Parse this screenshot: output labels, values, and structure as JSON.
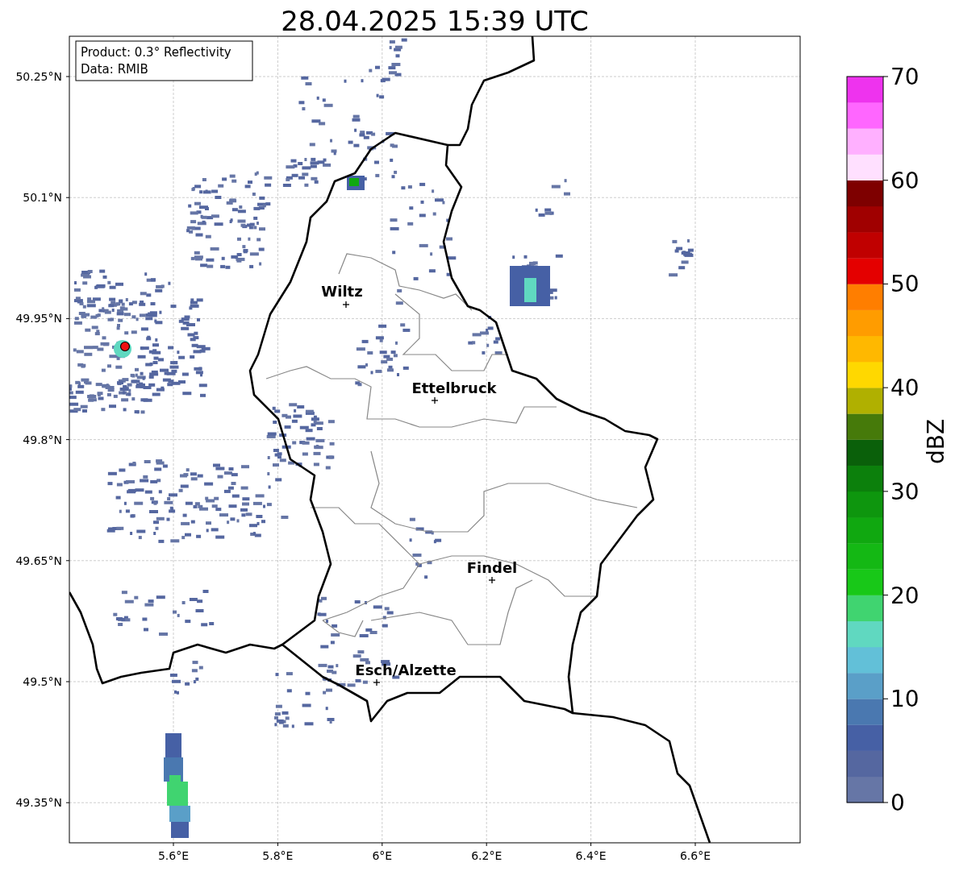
{
  "title": "28.04.2025 15:39 UTC",
  "info_box": [
    "Product: 0.3° Reflectivity",
    "Data: RMIB"
  ],
  "y_ticks": [
    "50.25°N",
    "50.1°N",
    "49.95°N",
    "49.8°N",
    "49.65°N",
    "49.5°N",
    "49.35°N"
  ],
  "x_ticks": [
    "5.6°E",
    "5.8°E",
    "6°E",
    "6.2°E",
    "6.4°E",
    "6.6°E"
  ],
  "cities": [
    {
      "name": "Wiltz"
    },
    {
      "name": "Ettelbruck"
    },
    {
      "name": "Findel"
    },
    {
      "name": "Esch/Alzette"
    }
  ],
  "colorbar": {
    "label": "dBZ",
    "ticks": [
      "70",
      "60",
      "50",
      "40",
      "30",
      "20",
      "10",
      "0"
    ],
    "bands": [
      {
        "color": "#6676a6"
      },
      {
        "color": "#5567a0"
      },
      {
        "color": "#4660a5"
      },
      {
        "color": "#4a78b0"
      },
      {
        "color": "#5a9fc8"
      },
      {
        "color": "#62c0d8"
      },
      {
        "color": "#60d8c0"
      },
      {
        "color": "#40d470"
      },
      {
        "color": "#18c818"
      },
      {
        "color": "#14b814"
      },
      {
        "color": "#10a810"
      },
      {
        "color": "#0e960e"
      },
      {
        "color": "#0c800c"
      },
      {
        "color": "#0a600a"
      },
      {
        "color": "#467a0a"
      },
      {
        "color": "#b0b000"
      },
      {
        "color": "#ffd800"
      },
      {
        "color": "#ffb800"
      },
      {
        "color": "#ff9c00"
      },
      {
        "color": "#ff7e00"
      },
      {
        "color": "#e40000"
      },
      {
        "color": "#c00000"
      },
      {
        "color": "#a00000"
      },
      {
        "color": "#7e0000"
      },
      {
        "color": "#ffe0ff"
      },
      {
        "color": "#ffb0ff"
      },
      {
        "color": "#ff66ff"
      },
      {
        "color": "#ee33ee"
      }
    ]
  }
}
